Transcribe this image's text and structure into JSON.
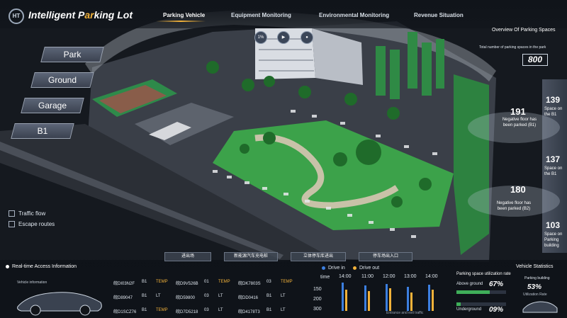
{
  "app": {
    "title_a": "Intelligent P",
    "title_hl": "ar",
    "title_b": "king Lot"
  },
  "nav": [
    "Parking Vehicle",
    "Equipment Monitoring",
    "Environmental Monitoring",
    "Revenue Situation"
  ],
  "round_buttons": [
    "1%",
    "▶",
    "●"
  ],
  "floors": [
    "Park",
    "Ground",
    "Garage",
    "B1"
  ],
  "legend": [
    "Traffic flow",
    "Escape routes"
  ],
  "overview": {
    "title": "Overview Of Parking Spaces",
    "subtitle": "Total number of parking spaces in the park",
    "total": "800",
    "spaces": [
      {
        "num": "139",
        "label": "Space on the B1"
      },
      {
        "num": "137",
        "label": "Space on the B1"
      },
      {
        "num": "103",
        "label": "Space on Parking building"
      }
    ],
    "parked": [
      {
        "num": "191",
        "label": "Negative floor has been parked (B1)"
      },
      {
        "num": "180",
        "label": "Negative floor has been parked (B2)"
      }
    ]
  },
  "tabs": [
    "进出场",
    "新能源汽车充电桩",
    "立体停车库进出",
    "停车场出入口"
  ],
  "access": {
    "title": "Real-time Access Information",
    "vehicle_info": "Vehicle information",
    "rows": [
      [
        [
          "皖DI03N2F",
          "B1",
          "TEMP"
        ],
        [
          "皖D9V526B",
          "01",
          "TEMP"
        ],
        [
          "皖DK7803S",
          "03",
          "TEMP"
        ]
      ],
      [
        [
          "皖D89047",
          "B1",
          "LT"
        ],
        [
          "皖D59800",
          "03",
          "LT"
        ],
        [
          "皖DD0416",
          "B1",
          "LT"
        ]
      ],
      [
        [
          "皖D1SCZ76",
          "B1",
          "TEMP"
        ],
        [
          "皖D7D5218",
          "03",
          "LT"
        ],
        [
          "皖D4178T3",
          "B1",
          "LT"
        ]
      ]
    ]
  },
  "flow_chart": {
    "legend": [
      "Drive in",
      "Drive out"
    ],
    "time_label": "time",
    "times": [
      "14:00",
      "11:00",
      "12:00",
      "13:00",
      "14:00"
    ],
    "y_ticks": [
      "150",
      "200",
      "300"
    ],
    "caption": "Entrance and exit traffic",
    "colors": {
      "in": "#3c7fe0",
      "out": "#f2b23a"
    }
  },
  "utilization": {
    "title": "Parking space utilization rate",
    "rows": [
      {
        "label": "Above ground",
        "value": "67%",
        "fill": 0.67
      },
      {
        "label": "Underground",
        "value": "09%",
        "fill": 0.09
      }
    ]
  },
  "vehicle_stats": {
    "title": "Vehicle Statistics",
    "label": "Parking building",
    "value": "53%",
    "sub": "Utilization Rate"
  }
}
